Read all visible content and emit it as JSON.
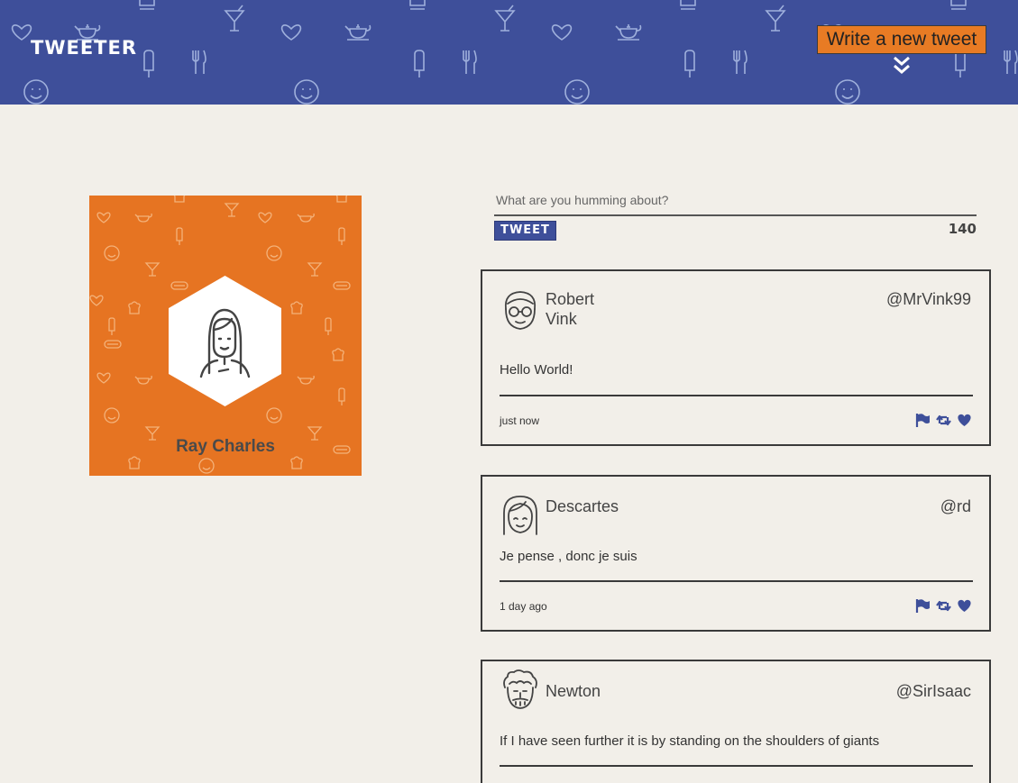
{
  "header": {
    "logo": "TWEETER",
    "compose_button": "Write a new tweet",
    "background_color": "#3e4f9a",
    "accent_color": "#e67422",
    "pattern_icons": [
      "heart-icon",
      "cocktail-icon",
      "teapot-icon",
      "fork-knife-icon",
      "popsicle-icon",
      "smiley-icon",
      "chef-hat-icon"
    ]
  },
  "profile": {
    "name": "Ray Charles",
    "avatar_icon": "woman-avatar-icon"
  },
  "composer": {
    "placeholder": "What are you humming about?",
    "value": "",
    "submit_label": "TWEET",
    "char_counter": "140"
  },
  "tweets": [
    {
      "name_first": "Robert",
      "name_last": "Vink",
      "handle": "@MrVink99",
      "text": "Hello World!",
      "time": "just now",
      "avatar_icon": "man-glasses-avatar-icon"
    },
    {
      "name_first": "Descartes",
      "name_last": "",
      "handle": "@rd",
      "text": "Je pense , donc je suis",
      "time": "1 day ago",
      "avatar_icon": "bob-hair-avatar-icon"
    },
    {
      "name_first": "Newton",
      "name_last": "",
      "handle": "@SirIsaac",
      "text": "If I have seen further it is by standing on the shoulders of giants",
      "time": "",
      "avatar_icon": "curly-hair-avatar-icon"
    }
  ],
  "tweet_actions": [
    "flag-icon",
    "retweet-icon",
    "heart-icon"
  ]
}
